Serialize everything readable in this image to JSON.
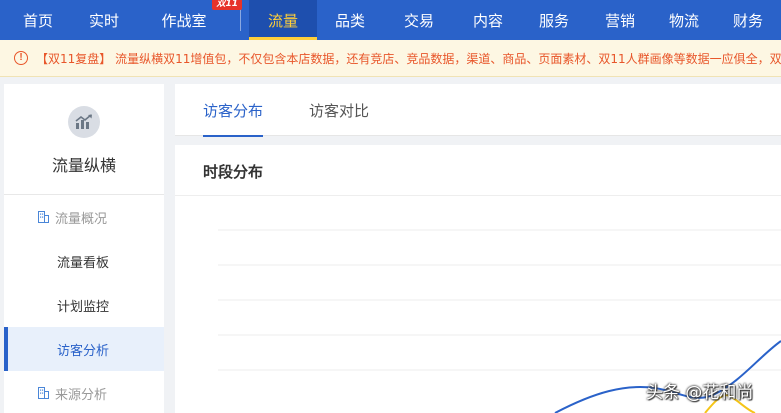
{
  "topnav": {
    "items": [
      {
        "label": "首页"
      },
      {
        "label": "实时"
      },
      {
        "label": "作战室",
        "badge": "双11"
      },
      {
        "label": "流量",
        "active": true
      },
      {
        "label": "品类"
      },
      {
        "label": "交易"
      },
      {
        "label": "内容"
      },
      {
        "label": "服务"
      },
      {
        "label": "营销"
      },
      {
        "label": "物流"
      },
      {
        "label": "财务"
      }
    ],
    "colors": {
      "bg": "#2a62c9",
      "active_text": "#ffcf3a"
    }
  },
  "notice": {
    "icon": "alert-circle-icon",
    "text": "【双11复盘】 流量纵横双11增值包，不仅包含本店数据，还有竞店、竞品数据，渠道、商品、页面素材、双11人群画像等数据一应俱全，双"
  },
  "sidebar": {
    "logo_icon": "trend-chart-icon",
    "title": "流量纵横",
    "groups": [
      {
        "label": "流量概况",
        "icon": "building-icon",
        "items": [
          {
            "label": "流量看板"
          },
          {
            "label": "计划监控"
          },
          {
            "label": "访客分析",
            "active": true
          }
        ]
      },
      {
        "label": "来源分析",
        "icon": "building-icon",
        "items": []
      }
    ]
  },
  "tabs": [
    {
      "label": "访客分布",
      "active": true
    },
    {
      "label": "访客对比"
    }
  ],
  "panel": {
    "title": "时段分布"
  },
  "watermark": "头条 @花和尚"
}
